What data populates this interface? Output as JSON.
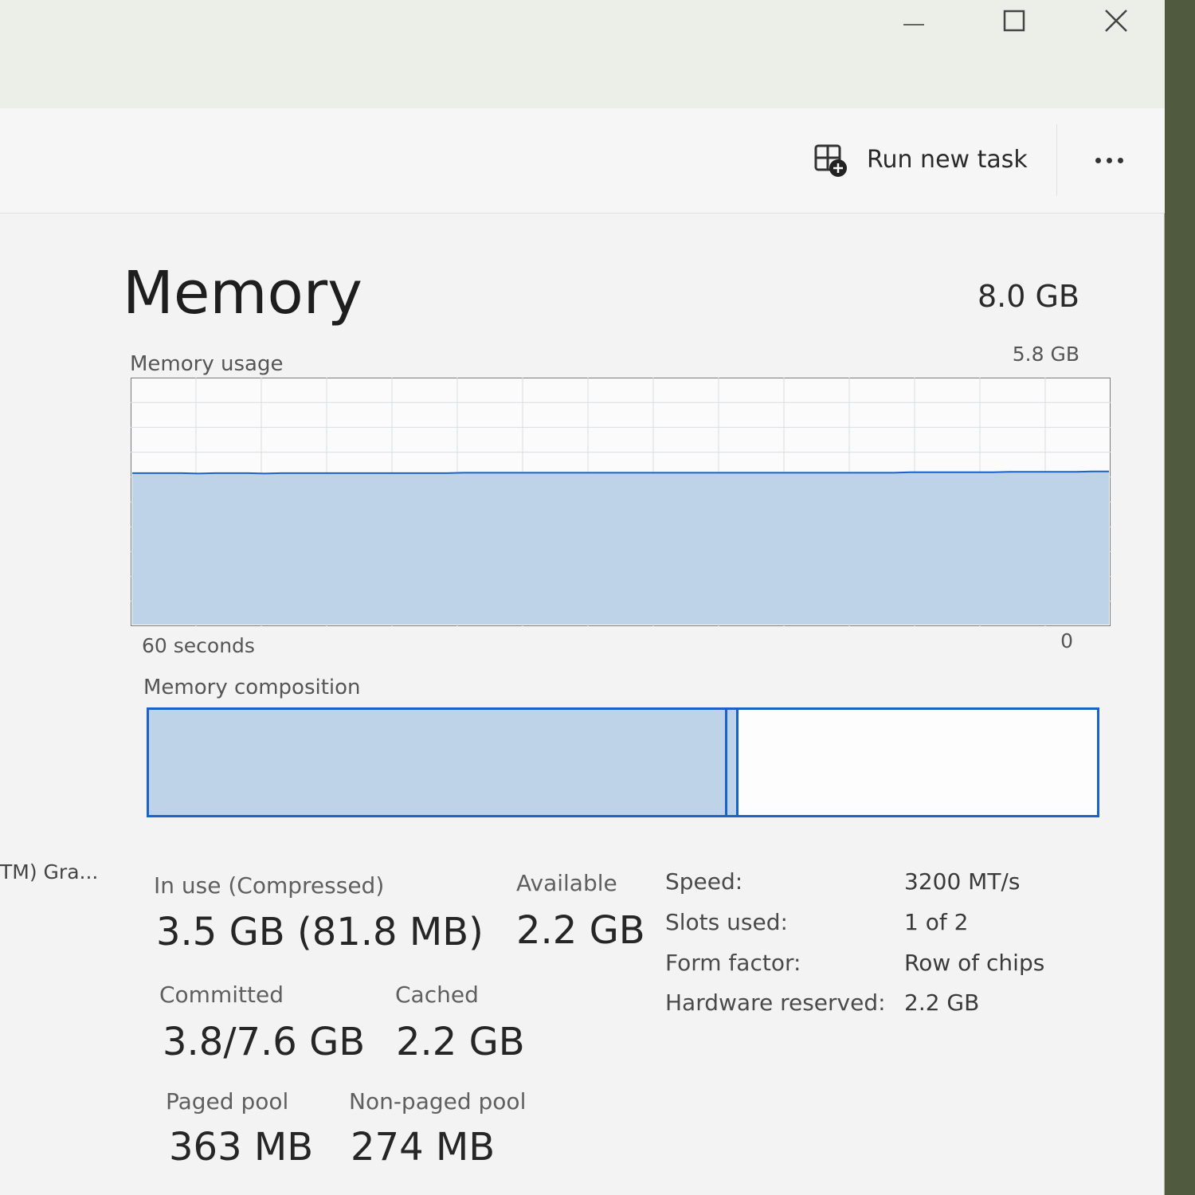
{
  "window_controls": {
    "minimize_icon": "minimize-icon",
    "maximize_icon": "maximize-icon",
    "close_icon": "close-icon"
  },
  "toolbar": {
    "run_new_task_label": "Run new task",
    "run_new_task_icon": "run-task-icon",
    "more_icon": "more-options-icon"
  },
  "sidebar": {
    "partial_item_label": "TM) Gra..."
  },
  "memory": {
    "title": "Memory",
    "total": "8.0 GB",
    "usage_label": "Memory usage",
    "usage_max": "5.8 GB",
    "axis_left": "60 seconds",
    "axis_right": "0",
    "composition_label": "Memory composition",
    "composition": {
      "in_use_fraction": 0.61,
      "modified_fraction": 0.012,
      "fill_color": "#bfd3e8",
      "border_color": "#1a62c6"
    }
  },
  "chart_data": {
    "type": "area",
    "title": "Memory usage",
    "xlabel": "",
    "ylabel": "",
    "x_range_labels": [
      "60 seconds",
      "0"
    ],
    "ylim": [
      0,
      5.8
    ],
    "unit": "GB",
    "grid": true,
    "series": [
      {
        "values": [
          3.58,
          3.58,
          3.58,
          3.58,
          3.57,
          3.58,
          3.58,
          3.58,
          3.57,
          3.58,
          3.58,
          3.58,
          3.58,
          3.58,
          3.58,
          3.58,
          3.58,
          3.58,
          3.58,
          3.58,
          3.59,
          3.59,
          3.59,
          3.59,
          3.59,
          3.59,
          3.59,
          3.59,
          3.59,
          3.59,
          3.59,
          3.59,
          3.59,
          3.59,
          3.59,
          3.59,
          3.59,
          3.59,
          3.59,
          3.59,
          3.59,
          3.59,
          3.59,
          3.59,
          3.59,
          3.59,
          3.59,
          3.6,
          3.6,
          3.6,
          3.6,
          3.6,
          3.6,
          3.61,
          3.61,
          3.61,
          3.61,
          3.61,
          3.62,
          3.62
        ]
      }
    ],
    "line_color": "#1a62c6",
    "fill_color": "#bfd3e8"
  },
  "stats": {
    "in_use_label": "In use (Compressed)",
    "in_use_value": "3.5 GB (81.8 MB)",
    "available_label": "Available",
    "available_value": "2.2 GB",
    "committed_label": "Committed",
    "committed_value": "3.8/7.6 GB",
    "cached_label": "Cached",
    "cached_value": "2.2 GB",
    "paged_pool_label": "Paged pool",
    "paged_pool_value": "363 MB",
    "non_paged_pool_label": "Non-paged pool",
    "non_paged_pool_value": "274 MB"
  },
  "specs": [
    {
      "label": "Speed:",
      "value": "3200 MT/s"
    },
    {
      "label": "Slots used:",
      "value": "1 of 2"
    },
    {
      "label": "Form factor:",
      "value": "Row of chips"
    },
    {
      "label": "Hardware reserved:",
      "value": "2.2 GB"
    }
  ]
}
